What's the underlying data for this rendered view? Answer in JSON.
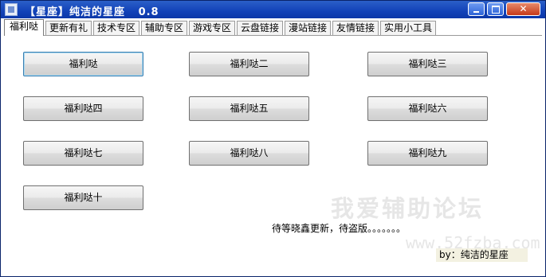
{
  "window": {
    "title": "【星座】纯洁的星座   0.8",
    "controls": {
      "minimize": "_",
      "maximize": "□",
      "close": "✕"
    }
  },
  "tabs": [
    {
      "label": "福利哒",
      "active": true
    },
    {
      "label": "更新有礼",
      "active": false
    },
    {
      "label": "技术专区",
      "active": false
    },
    {
      "label": "辅助专区",
      "active": false
    },
    {
      "label": "游戏专区",
      "active": false
    },
    {
      "label": "云盘链接",
      "active": false
    },
    {
      "label": "漫站链接",
      "active": false
    },
    {
      "label": "友情链接",
      "active": false
    },
    {
      "label": "实用小工具",
      "active": false
    }
  ],
  "buttons": [
    "福利哒",
    "福利哒二",
    "福利哒三",
    "福利哒四",
    "福利哒五",
    "福利哒六",
    "福利哒七",
    "福利哒八",
    "福利哒九",
    "福利哒十"
  ],
  "status_text": "待等晓鑫更新，待盗版。。。。。。。",
  "credit_text": "by：纯洁的星座",
  "watermark": {
    "line1": "我爱辅助论坛",
    "line2": "www.52fzba.com"
  }
}
